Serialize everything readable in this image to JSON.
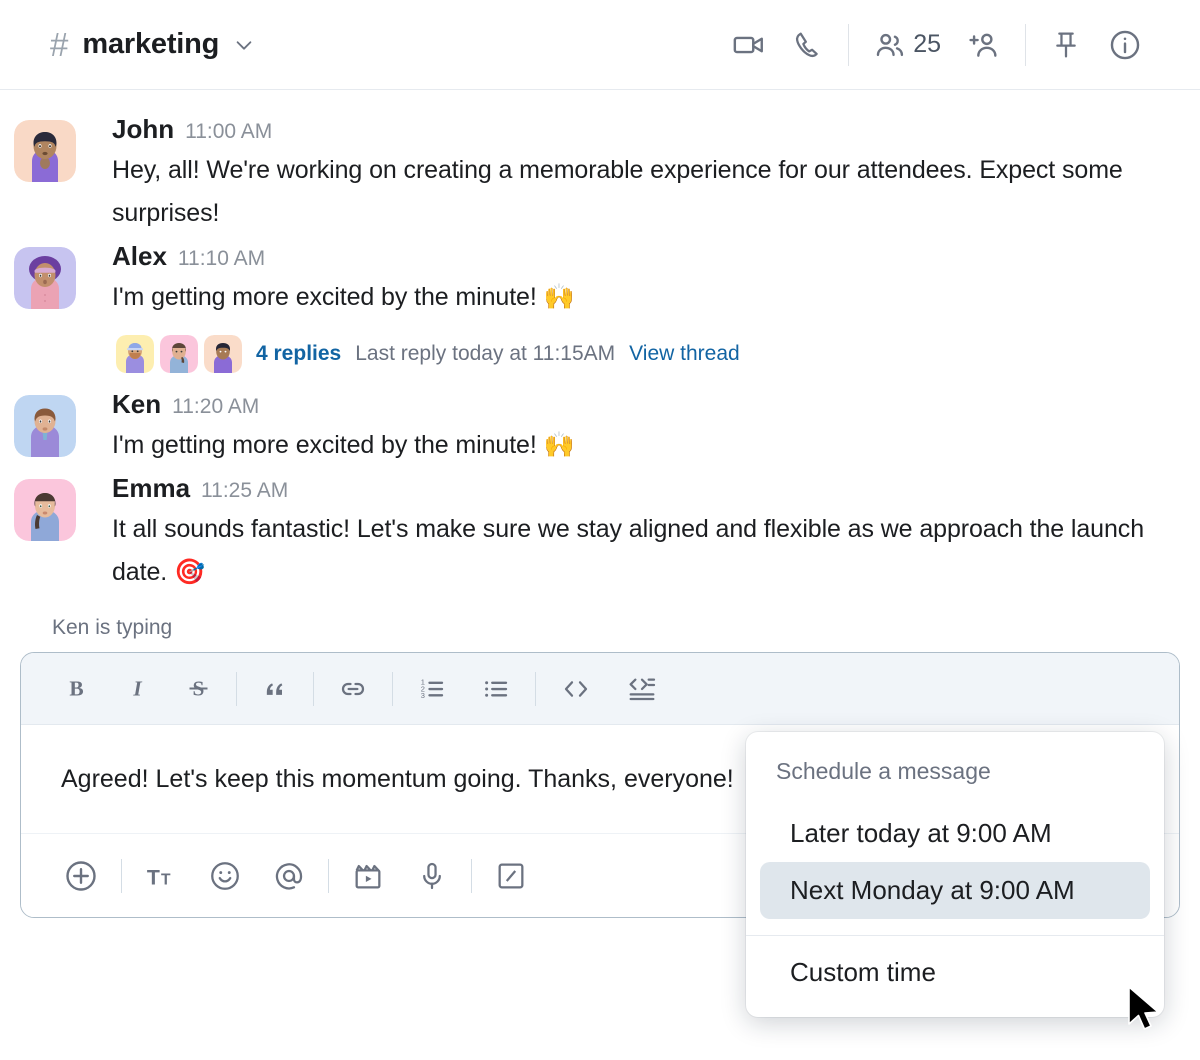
{
  "header": {
    "hash": "#",
    "channel_name": "marketing",
    "chevron_icon": "chevron-down-icon",
    "video_icon": "video-camera-icon",
    "call_icon": "phone-icon",
    "members_icon": "members-icon",
    "member_count": "25",
    "add_member_icon": "add-person-icon",
    "pin_icon": "pin-icon",
    "info_icon": "info-icon"
  },
  "messages": [
    {
      "author": "John",
      "time": "11:00 AM",
      "text": "Hey, all! We're working on creating a memorable experience for our attendees. Expect some surprises!",
      "avatar": "john-avatar"
    },
    {
      "author": "Alex",
      "time": "11:10 AM",
      "text": "I'm getting more excited by the minute! 🙌",
      "avatar": "alex-avatar",
      "thread": {
        "replies_count": "4 replies",
        "last_reply": "Last reply today at 11:15AM",
        "view_thread": "View thread"
      }
    },
    {
      "author": "Ken",
      "time": "11:20 AM",
      "text": "I'm getting more excited by the minute! 🙌",
      "avatar": "ken-avatar"
    },
    {
      "author": "Emma",
      "time": "11:25 AM",
      "text": "It all sounds fantastic! Let's make sure we stay aligned and flexible as we approach the launch date. 🎯",
      "avatar": "emma-avatar"
    }
  ],
  "typing_status": "Ken is typing",
  "composer": {
    "input_value": "Agreed! Let's keep this momentum going. Thanks, everyone!",
    "format_tools": [
      {
        "name": "bold-icon",
        "label": "B"
      },
      {
        "name": "italic-icon",
        "label": "I"
      },
      {
        "name": "strikethrough-icon",
        "label": "S"
      },
      {
        "name": "blockquote-icon",
        "label": "””"
      },
      {
        "name": "link-icon",
        "label": "link"
      },
      {
        "name": "ordered-list-icon",
        "label": "ordered list"
      },
      {
        "name": "bullet-list-icon",
        "label": "bullet list"
      },
      {
        "name": "code-icon",
        "label": "< >"
      },
      {
        "name": "code-block-icon",
        "label": "code block"
      }
    ],
    "action_tools": [
      {
        "name": "plus-circle-icon",
        "label": "attach"
      },
      {
        "name": "text-format-icon",
        "label": "Tt"
      },
      {
        "name": "emoji-icon",
        "label": "emoji"
      },
      {
        "name": "mention-icon",
        "label": "@"
      },
      {
        "name": "video-clip-icon",
        "label": "video clip"
      },
      {
        "name": "microphone-icon",
        "label": "audio"
      },
      {
        "name": "slash-command-icon",
        "label": "slash command"
      }
    ],
    "send_icon": "send-icon",
    "send_caret_icon": "caret-down-icon",
    "send_color": "#6A2FB5"
  },
  "schedule_menu": {
    "title": "Schedule a message",
    "options": [
      {
        "label": "Later today at 9:00 AM",
        "highlighted": false
      },
      {
        "label": "Next Monday at 9:00 AM",
        "highlighted": true
      }
    ],
    "custom_option": "Custom time"
  },
  "colors": {
    "accent_purple": "#6A2FB5",
    "link_blue": "#1264A3",
    "toolbar_bg": "#F1F5F9",
    "border": "#AEBDC9"
  }
}
